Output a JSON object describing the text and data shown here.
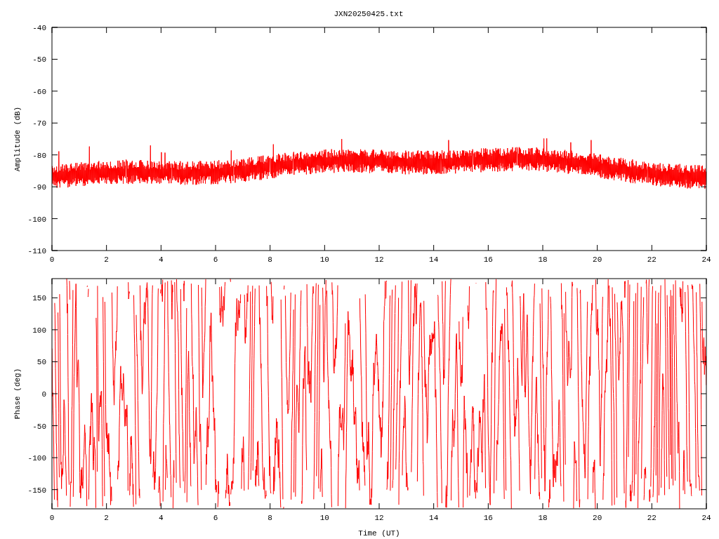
{
  "title": "JXN20250425.txt",
  "panels": [
    {
      "kind": "amplitude",
      "ylabel": "Amplitude (dB)",
      "yticks": [
        "-40",
        "-50",
        "-60",
        "-70",
        "-80",
        "-90",
        "-100",
        "-110"
      ],
      "xticks": [
        "0",
        "2",
        "4",
        "6",
        "8",
        "10",
        "12",
        "14",
        "16",
        "18",
        "20",
        "22",
        "24"
      ]
    },
    {
      "kind": "phase",
      "ylabel": "Phase (deg)",
      "yticks": [
        "150",
        "100",
        "50",
        "0",
        "-50",
        "-100",
        "-150"
      ],
      "xticks": [
        "0",
        "2",
        "4",
        "6",
        "8",
        "10",
        "12",
        "14",
        "16",
        "18",
        "20",
        "22",
        "24"
      ],
      "xlabel": "Time (UT)"
    }
  ]
}
